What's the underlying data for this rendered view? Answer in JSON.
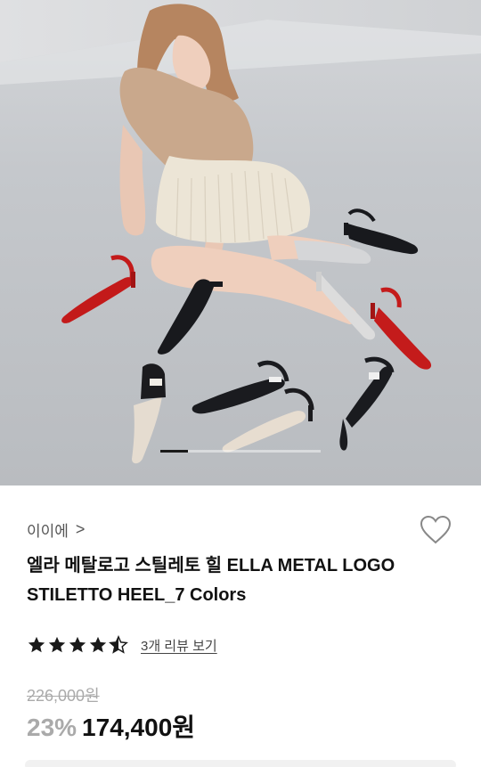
{
  "brand": {
    "name": "이이에",
    "chevron": ">"
  },
  "product": {
    "title": "엘라 메탈로고 스틸레토 힐 ELLA METAL LOGO STILETTO HEEL_7 Colors"
  },
  "rating": {
    "stars": 4.5,
    "review_link": "3개 리뷰 보기"
  },
  "price": {
    "original": "226,000원",
    "discount": "23%",
    "sale": "174,400원"
  },
  "carousel": {
    "current": 1,
    "progress": 0.17
  },
  "icons": {
    "wishlist": "heart-outline-icon",
    "star": "star-icon"
  },
  "colors": {
    "accent": "#111111",
    "muted": "#aaaaaa",
    "star": "#1a1a1a"
  }
}
